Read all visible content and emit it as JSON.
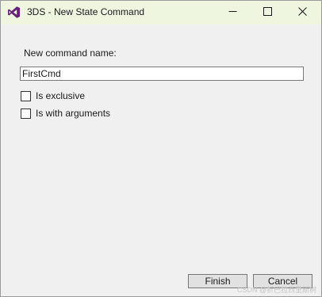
{
  "window": {
    "title": "3DS - New State Command",
    "icon": "visual-studio-icon",
    "controls": {
      "minimize": "minimize-icon",
      "maximize": "maximize-icon",
      "close": "close-icon"
    }
  },
  "form": {
    "name_label": "New command name:",
    "name_value": "FirstCmd",
    "checkboxes": [
      {
        "label": "Is exclusive",
        "checked": false
      },
      {
        "label": "Is with arguments",
        "checked": false
      }
    ]
  },
  "buttons": {
    "finish": "Finish",
    "cancel": "Cancel"
  },
  "watermark": "CSDN @折巴拉西里斯树",
  "colors": {
    "titlebar": "#eef6e0",
    "background": "#f0f0f0",
    "icon_purple": "#68217a"
  }
}
